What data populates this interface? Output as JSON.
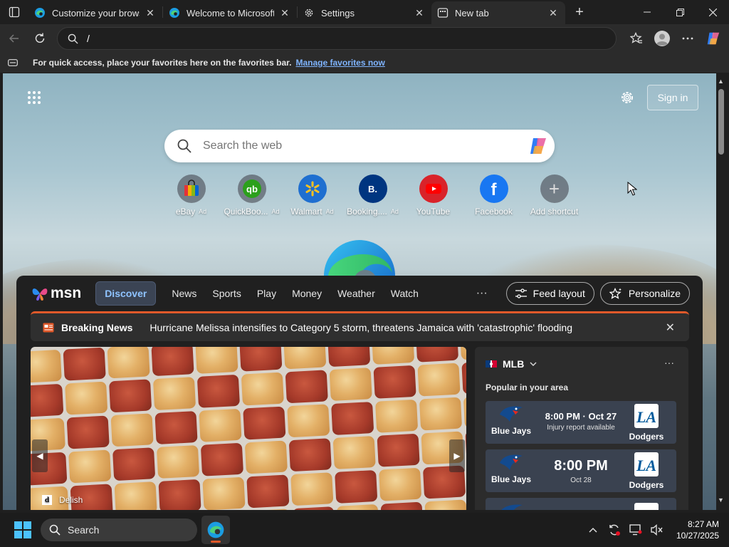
{
  "tabs": [
    {
      "title": "Customize your browser",
      "icon": "edge-icon",
      "active": false
    },
    {
      "title": "Welcome to Microsoft Ed",
      "icon": "edge-icon",
      "active": false
    },
    {
      "title": "Settings",
      "icon": "gear-icon",
      "active": false
    },
    {
      "title": "New tab",
      "icon": "newtab-icon",
      "active": true
    }
  ],
  "tab_close": "✕",
  "new_tab_label": "+",
  "address": {
    "value": "/"
  },
  "favorites_bar": {
    "message": "For quick access, place your favorites here on the favorites bar.",
    "link": "Manage favorites now"
  },
  "newtab": {
    "sign_in": "Sign in",
    "search_placeholder": "Search the web",
    "shortcuts": [
      {
        "label": "eBay",
        "ad": "Ad",
        "icon": "ebay-icon"
      },
      {
        "label": "QuickBoo...",
        "ad": "Ad",
        "icon": "quickbooks-icon"
      },
      {
        "label": "Walmart",
        "ad": "Ad",
        "icon": "walmart-icon"
      },
      {
        "label": "Booking....",
        "ad": "Ad",
        "icon": "booking-icon",
        "glyph": "B."
      },
      {
        "label": "YouTube",
        "ad": "",
        "icon": "youtube-icon"
      },
      {
        "label": "Facebook",
        "ad": "",
        "icon": "facebook-icon",
        "glyph": "f"
      },
      {
        "label": "Add shortcut",
        "ad": "",
        "icon": "plus-icon",
        "glyph": "+"
      }
    ]
  },
  "feed": {
    "brand": "msn",
    "nav": [
      "Discover",
      "News",
      "Sports",
      "Play",
      "Money",
      "Weather",
      "Watch"
    ],
    "more": "···",
    "feed_layout": "Feed layout",
    "personalize": "Personalize",
    "breaking": {
      "label": "Breaking News",
      "headline": "Hurricane Melissa intensifies to Category 5 storm, threatens Jamaica with 'catastrophic' flooding",
      "close": "✕"
    },
    "hero": {
      "source": "Delish",
      "source_glyph": "d"
    },
    "mlb": {
      "league": "MLB",
      "more": "···",
      "subtitle": "Popular in your area",
      "games": [
        {
          "home": "Blue Jays",
          "away": "Dodgers",
          "time": "8:00 PM · Oct 27",
          "note": "Injury report available",
          "layout": "small"
        },
        {
          "home": "Blue Jays",
          "away": "Dodgers",
          "time": "8:00 PM",
          "note": "Oct 28",
          "layout": "large"
        }
      ]
    }
  },
  "taskbar": {
    "search_label": "Search",
    "time": "8:27 AM",
    "date": "10/27/2025"
  },
  "colors": {
    "accent_orange": "#e0592a",
    "link_blue": "#7fb4ff",
    "discover_text": "#8fc3ff",
    "jays_blue": "#134a8e",
    "dodgers_blue": "#005a9c"
  }
}
